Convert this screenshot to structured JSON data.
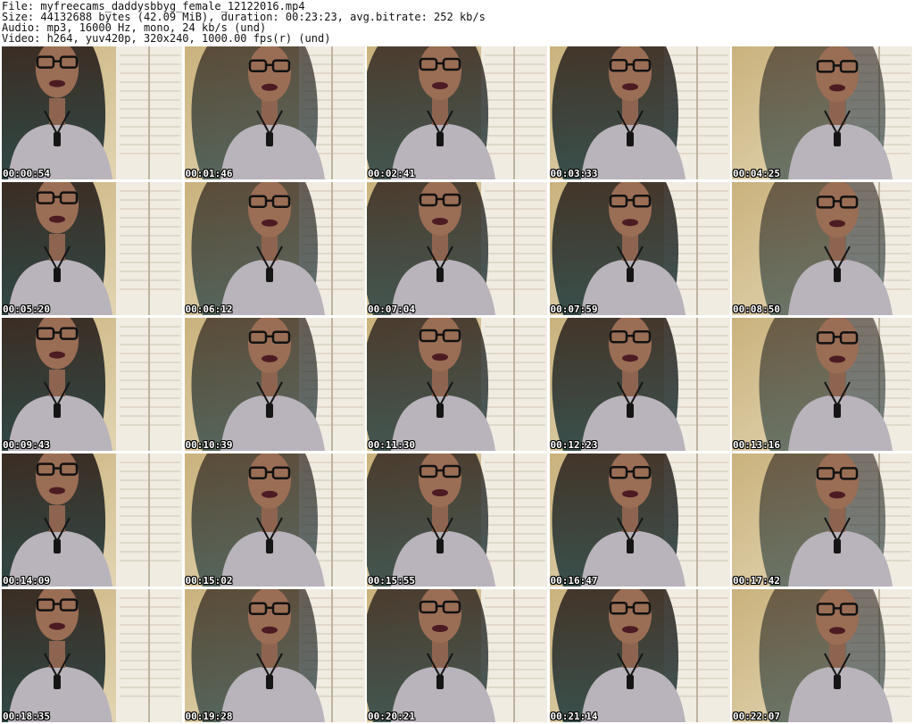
{
  "header": {
    "file": "File: myfreecams_daddysbbyg_female_12122016.mp4",
    "size": "Size: 44132688 bytes (42.09 MiB), duration: 00:23:23, avg.bitrate: 252 kb/s",
    "audio": "Audio: mp3, 16000 Hz, mono, 24 kb/s (und)",
    "video": "Video: h264, yuv420p, 320x240, 1000.00 fps(r) (und)"
  },
  "thumbnails": [
    {
      "time": "00:00:54"
    },
    {
      "time": "00:01:46"
    },
    {
      "time": "00:02:41"
    },
    {
      "time": "00:03:33"
    },
    {
      "time": "00:04:25"
    },
    {
      "time": "00:05:20"
    },
    {
      "time": "00:06:12"
    },
    {
      "time": "00:07:04"
    },
    {
      "time": "00:07:59"
    },
    {
      "time": "00:08:50"
    },
    {
      "time": "00:09:43"
    },
    {
      "time": "00:10:39"
    },
    {
      "time": "00:11:30"
    },
    {
      "time": "00:12:23"
    },
    {
      "time": "00:13:16"
    },
    {
      "time": "00:14:09"
    },
    {
      "time": "00:15:02"
    },
    {
      "time": "00:15:55"
    },
    {
      "time": "00:16:47"
    },
    {
      "time": "00:17:42"
    },
    {
      "time": "00:18:35"
    },
    {
      "time": "00:19:28"
    },
    {
      "time": "00:20:21"
    },
    {
      "time": "00:21:14"
    },
    {
      "time": "00:22:07"
    }
  ]
}
